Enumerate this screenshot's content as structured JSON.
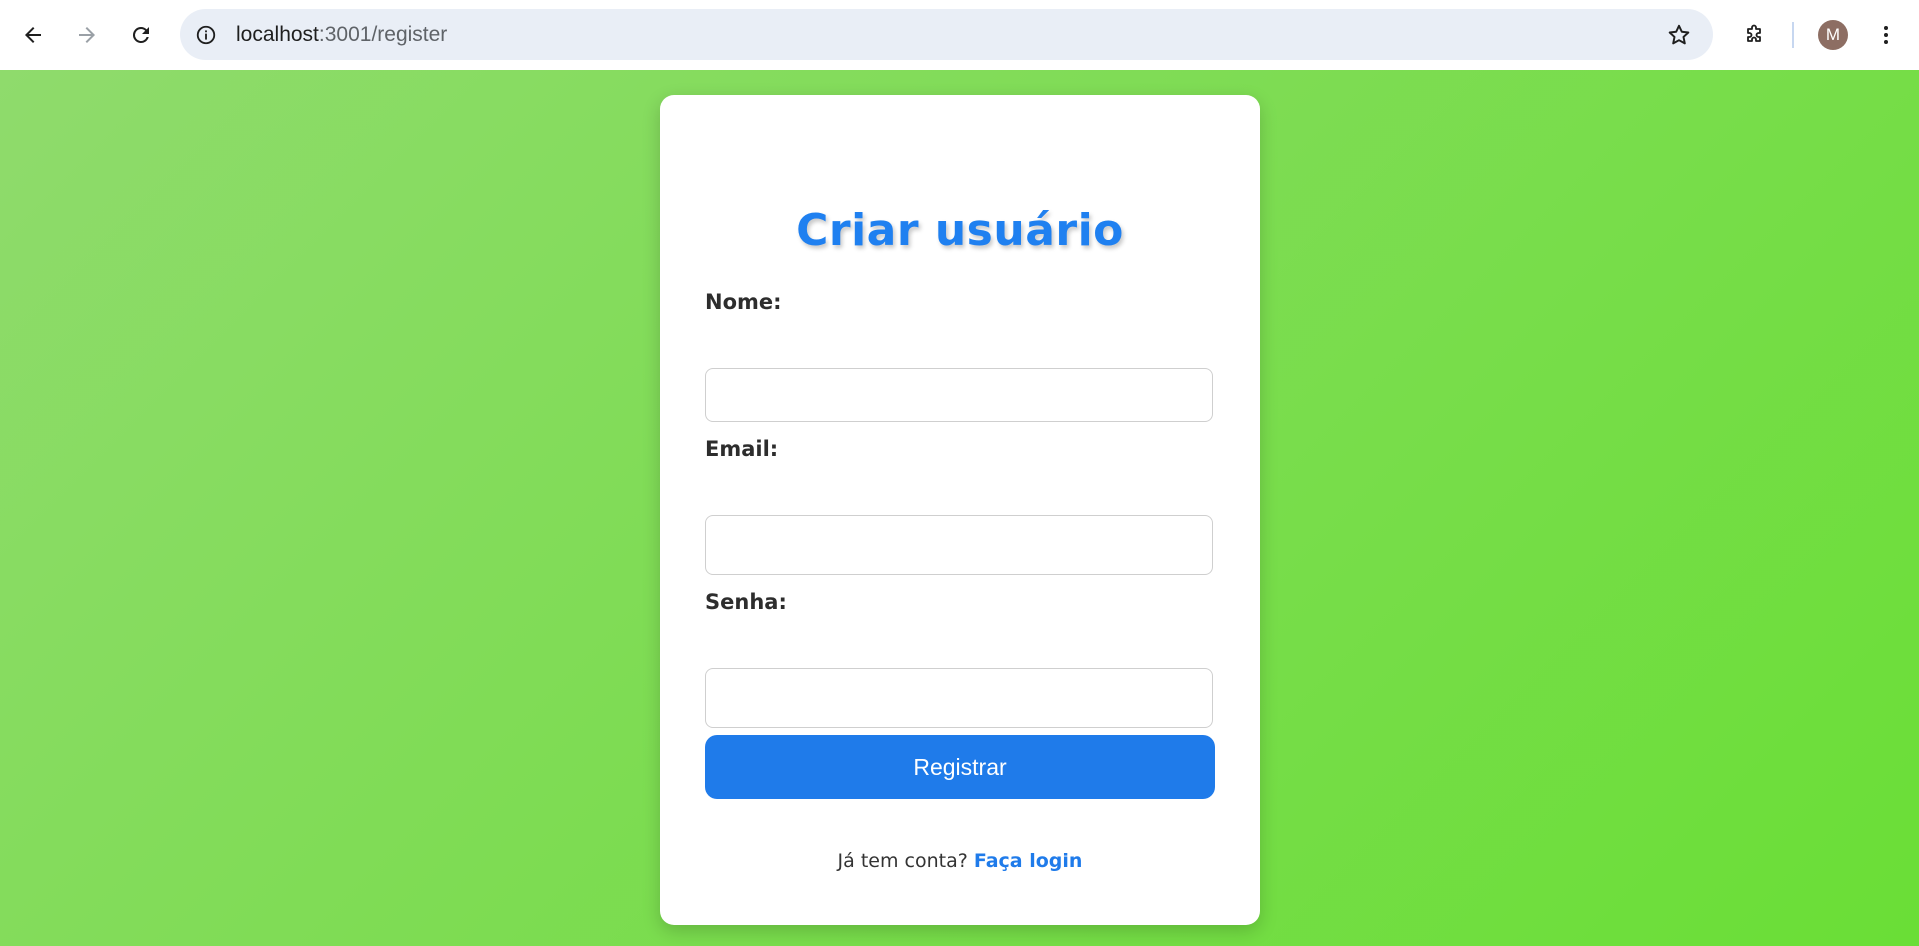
{
  "browser": {
    "url_host": "localhost",
    "url_path": ":3001/register",
    "avatar_initial": "M",
    "icons": {
      "back": "arrow-left-icon",
      "forward": "arrow-right-icon",
      "reload": "reload-icon",
      "site_info": "info-icon",
      "bookmark": "star-icon",
      "extensions": "puzzle-icon",
      "menu": "kebab-menu-icon"
    }
  },
  "page": {
    "background_start": "#8fdb6c",
    "background_end": "#6ade36"
  },
  "form": {
    "title": "Criar usuário",
    "title_color": "#1f80f0",
    "fields": [
      {
        "label": "Nome:",
        "value": ""
      },
      {
        "label": "Email:",
        "value": ""
      },
      {
        "label": "Senha:",
        "value": ""
      }
    ],
    "submit_label": "Registrar",
    "button_color": "#1f7bea",
    "footer_prompt": "Já tem conta?",
    "login_link": "Faça login"
  }
}
